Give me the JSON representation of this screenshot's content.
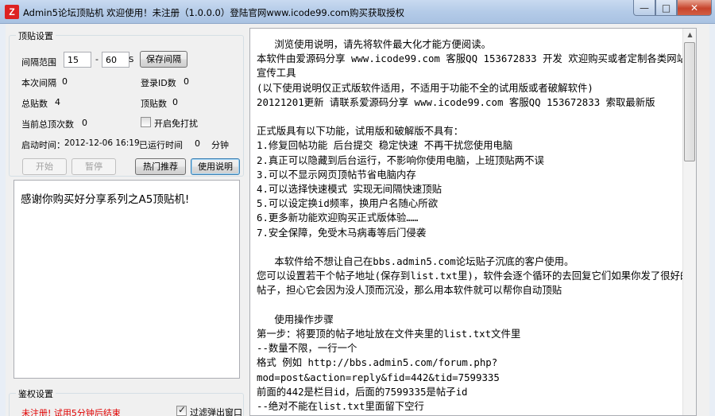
{
  "window": {
    "icon_glyph": "Z",
    "title": "Admin5论坛顶贴机 欢迎使用！未注册（1.0.0.0）登陆官网www.icode99.com购买获取授权",
    "min_glyph": "—",
    "max_glyph": "□",
    "close_glyph": "✕"
  },
  "settings": {
    "group_title": "顶贴设置",
    "interval_label": "间隔范围",
    "interval_min": "15",
    "interval_sep": "-",
    "interval_max": "60",
    "interval_unit": "S",
    "save_interval_button": "保存间隔",
    "this_interval_label": "本次间隔",
    "this_interval_value": "0",
    "login_id_label": "登录ID数",
    "login_id_value": "0",
    "total_posts_label": "总贴数",
    "total_posts_value": "4",
    "top_posts_label": "顶贴数",
    "top_posts_value": "0",
    "current_total_label": "当前总顶次数",
    "current_total_value": "0",
    "no_disturb_label": "开启免打扰",
    "start_time_label": "启动时间：",
    "start_time_value": "2012-12-06 16:19",
    "elapsed_label": "已运行时间",
    "elapsed_value": "0",
    "elapsed_unit": "分钟",
    "start_button": "开始",
    "pause_button": "暂停",
    "hot_button": "热门推荐",
    "help_button": "使用说明"
  },
  "thanks_text": "感谢你购买好分享系列之A5顶贴机!",
  "auth": {
    "group_title": "鉴权设置",
    "status_text": "未注册! 试用5分钟后结束",
    "filter_popup_label": "过滤弹出窗口"
  },
  "instructions": {
    "text": "   浏览使用说明，请先将软件最大化才能方便阅读。\n本软件由爱源码分享 www.icode99.com 客服QQ 153672833 开发 欢迎购买或者定制各类网站宣传工具\n(以下使用说明仅正式版软件适用，不适用于功能不全的试用版或者破解软件)\n20121201更新 请联系爱源码分享 www.icode99.com 客服QQ 153672833 索取最新版\n\n正式版具有以下功能，试用版和破解版不具有：\n1.修复回帖功能 后台提交 稳定快速 不再干扰您使用电脑\n2.真正可以隐藏到后台运行，不影响你使用电脑，上班顶贴两不误\n3.可以不显示网页顶帖节省电脑内存\n4.可以选择快速模式 实现无间隔快速顶贴\n5.可以设定换id频率，换用户名随心所欲\n6.更多新功能欢迎购买正式版体验……\n7.安全保障，免受木马病毒等后门侵袭\n\n   本软件给不想让自己在bbs.admin5.com论坛贴子沉底的客户使用。\n您可以设置若干个帖子地址(保存到list.txt里)，软件会逐个循环的去回复它们如果你发了很好的帖子，担心它会因为没人顶而沉没，那么用本软件就可以帮你自动顶贴\n\n   使用操作步骤\n第一步：将要顶的帖子地址放在文件夹里的list.txt文件里\n--数量不限，一行一个\n格式 例如 http://bbs.admin5.com/forum.php?mod=post&action=reply&fid=442&tid=7599335\n前面的442是栏目id，后面的7599335是帖子id\n--绝对不能在list.txt里面留下空行"
  },
  "scrollbar": {
    "up_glyph": "▲"
  },
  "colors": {
    "titlebar": "#b4cbe8",
    "warning_text": "#e00000",
    "close_button": "#c7442c"
  }
}
